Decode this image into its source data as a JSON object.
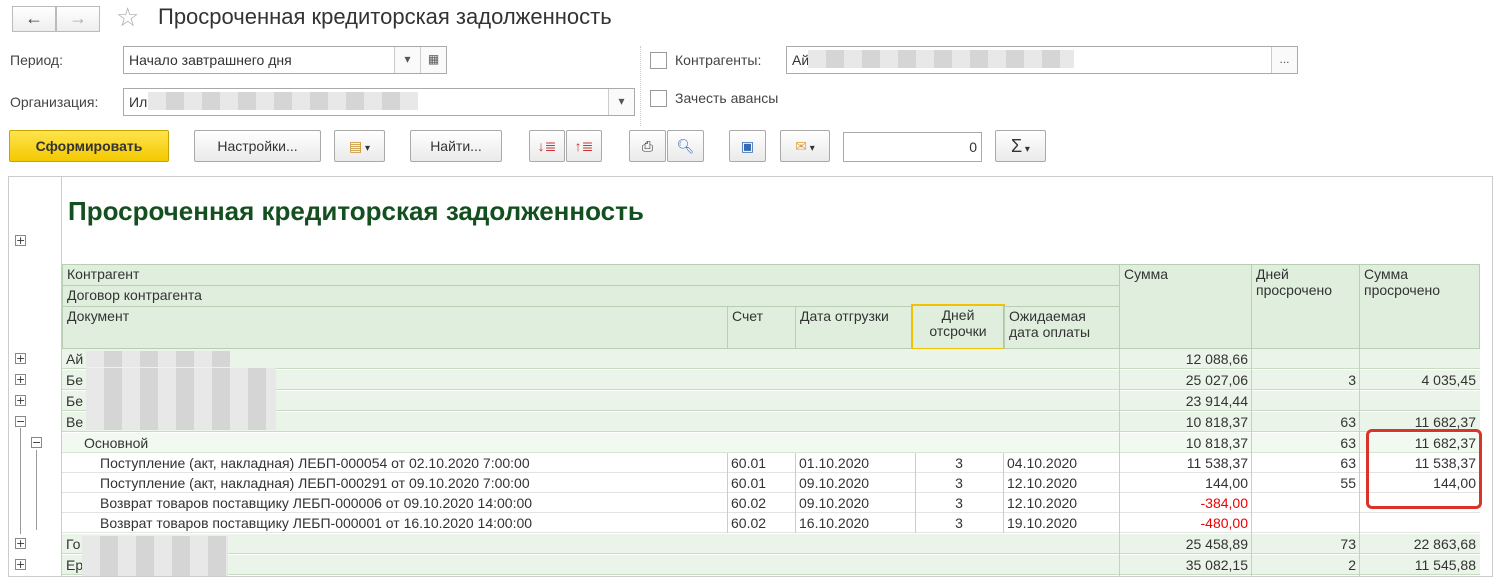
{
  "window": {
    "title": "Просроченная кредиторская задолженность",
    "back": "←",
    "forward": "→",
    "star": "☆"
  },
  "filters": {
    "period_label": "Период:",
    "period_value": "Начало завтрашнего дня",
    "org_label": "Организация:",
    "org_value": "Ил",
    "contr_label": "Контрагенты:",
    "contr_value": "Ай",
    "contr_btn": "...",
    "advance_label": "Зачесть авансы"
  },
  "toolbar": {
    "generate": "Сформировать",
    "settings": "Настройки...",
    "find": "Найти...",
    "counter_value": "0",
    "sum_symbol": "Σ"
  },
  "report": {
    "title": "Просроченная кредиторская задолженность",
    "headers": {
      "contragent": "Контрагент",
      "contract": "Договор контрагента",
      "document": "Документ",
      "account": "Счет",
      "ship_date": "Дата отгрузки",
      "delay_days": "Дней отсрочки",
      "expected_date": "Ожидаемая дата оплаты",
      "sum": "Сумма",
      "overdue_days": "Дней просрочено",
      "overdue_sum": "Сумма просрочено"
    },
    "rows": [
      {
        "type": "group",
        "name": "Ай",
        "sum": "12 088,66",
        "days": "",
        "osum": ""
      },
      {
        "type": "group",
        "name": "Бе",
        "sum": "25 027,06",
        "days": "3",
        "osum": "4 035,45"
      },
      {
        "type": "group",
        "name": "Бе",
        "sum": "23 914,44",
        "days": "",
        "osum": ""
      },
      {
        "type": "group",
        "name": "Ве",
        "sum": "10 818,37",
        "days": "63",
        "osum": "11 682,37"
      },
      {
        "type": "sub",
        "name": "Основной",
        "sum": "10 818,37",
        "days": "63",
        "osum": "11 682,37"
      },
      {
        "type": "det",
        "name": "Поступление (акт, накладная) ЛЕБП-000054 от 02.10.2020 7:00:00",
        "acc": "60.01",
        "ship": "01.10.2020",
        "delay": "3",
        "exp": "04.10.2020",
        "sum": "11 538,37",
        "days": "63",
        "osum": "11 538,37"
      },
      {
        "type": "det",
        "name": "Поступление (акт, накладная) ЛЕБП-000291 от 09.10.2020 7:00:00",
        "acc": "60.01",
        "ship": "09.10.2020",
        "delay": "3",
        "exp": "12.10.2020",
        "sum": "144,00",
        "days": "55",
        "osum": "144,00"
      },
      {
        "type": "det",
        "name": "Возврат товаров поставщику ЛЕБП-000006 от 09.10.2020 14:00:00",
        "acc": "60.02",
        "ship": "09.10.2020",
        "delay": "3",
        "exp": "12.10.2020",
        "sum": "-384,00",
        "days": "",
        "osum": "",
        "neg": true
      },
      {
        "type": "det",
        "name": "Возврат товаров поставщику ЛЕБП-000001 от 16.10.2020 14:00:00",
        "acc": "60.02",
        "ship": "16.10.2020",
        "delay": "3",
        "exp": "19.10.2020",
        "sum": "-480,00",
        "days": "",
        "osum": "",
        "neg": true
      },
      {
        "type": "group",
        "name": "Го",
        "sum": "25 458,89",
        "days": "73",
        "osum": "22 863,68"
      },
      {
        "type": "group",
        "name": "Ер",
        "sum": "35 082,15",
        "days": "2",
        "osum": "11 545,88"
      }
    ]
  },
  "colors": {
    "highlight_frame": "#d9342b",
    "delay_frame": "#f2c200",
    "title_green": "#14501f",
    "negative": "#e00000"
  }
}
